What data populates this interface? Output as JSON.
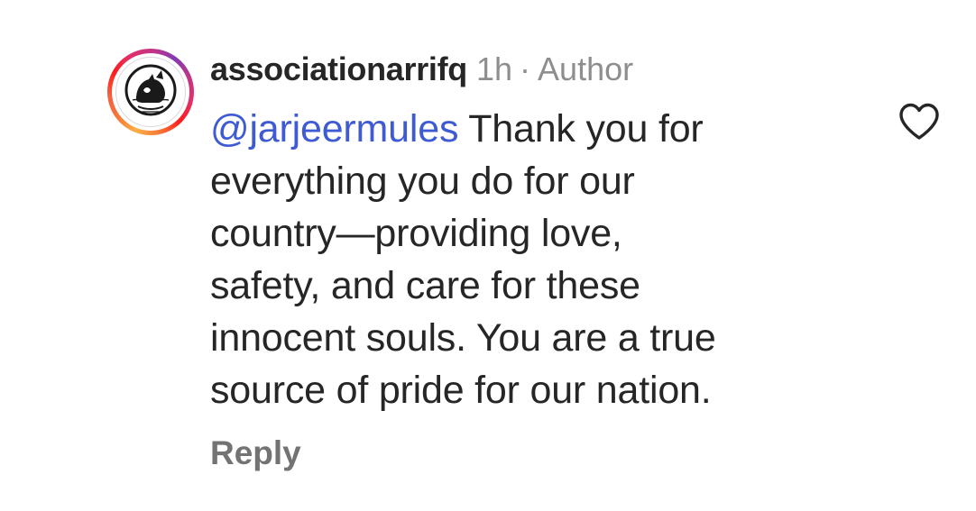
{
  "comment": {
    "username": "associationarrifq",
    "time": "1h",
    "separator": "·",
    "role_badge": "Author",
    "mention": "@jarjeermules",
    "text_lines": [
      " Thank you for",
      "everything you do for our",
      "country—providing love,",
      "safety, and care for these",
      "innocent souls. You are a true",
      "source of pride for our nation."
    ],
    "reply_label": "Reply",
    "like_icon": "heart-outline-icon",
    "avatar_icon": "animal-logo-icon",
    "colors": {
      "mention": "#3f5bd4",
      "text": "#262626",
      "muted": "#8e8e8e"
    }
  }
}
